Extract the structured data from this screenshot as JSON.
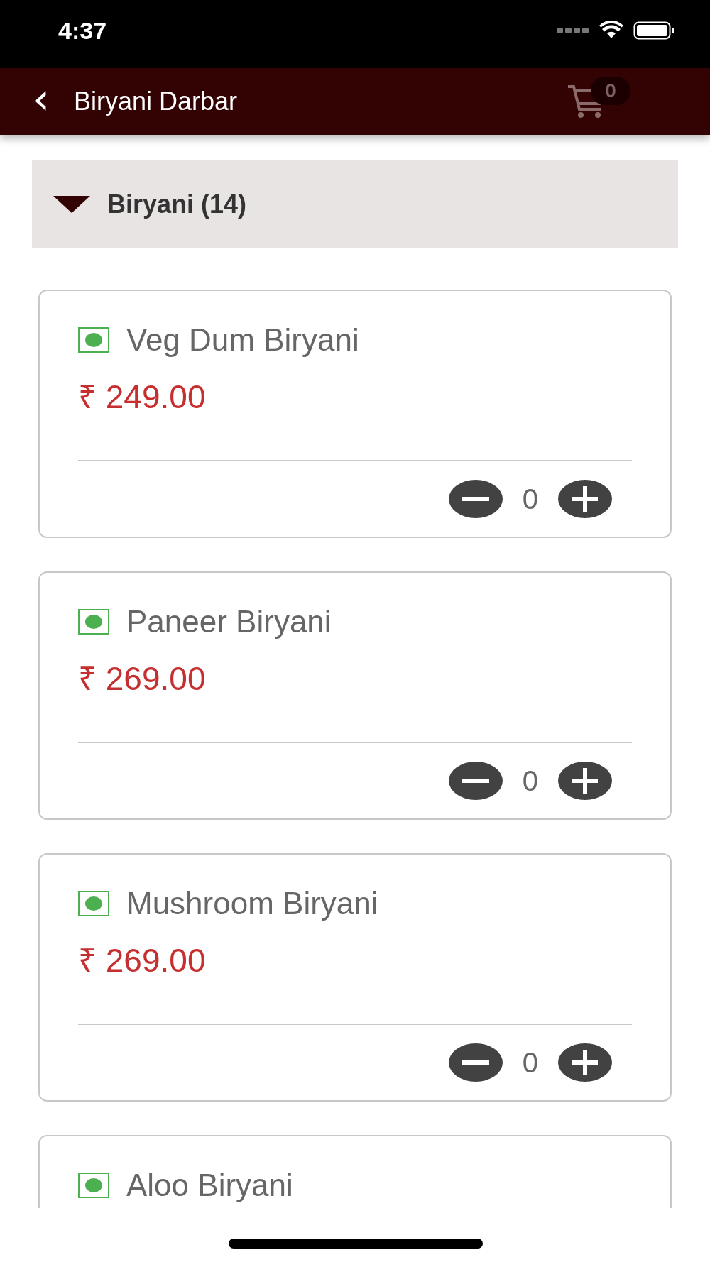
{
  "status_bar": {
    "time": "4:37"
  },
  "header": {
    "back_glyph": "‹",
    "title": "Biryani Darbar",
    "cart_count": "0"
  },
  "section": {
    "title": "Biryani (14)",
    "expanded": true
  },
  "items": [
    {
      "name": "Veg Dum Biryani",
      "veg": true,
      "price": "₹ 249.00",
      "quantity": "0"
    },
    {
      "name": "Paneer Biryani",
      "veg": true,
      "price": "₹ 269.00",
      "quantity": "0"
    },
    {
      "name": "Mushroom Biryani",
      "veg": true,
      "price": "₹ 269.00",
      "quantity": "0"
    },
    {
      "name": "Aloo Biryani",
      "veg": true
    }
  ]
}
